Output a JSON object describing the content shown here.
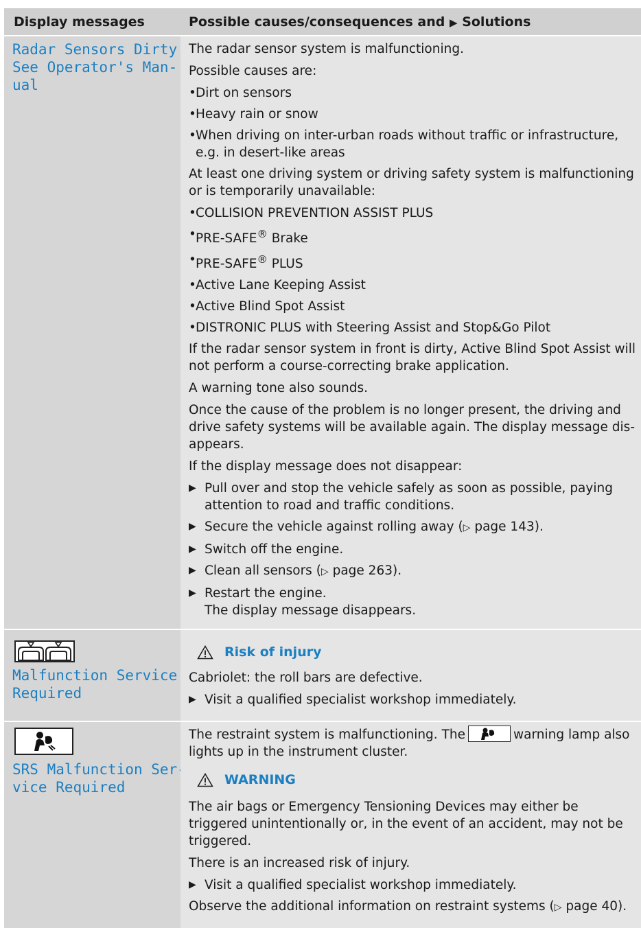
{
  "header": {
    "col1": "Display messages",
    "col2_prefix": "Possible causes/consequences and",
    "col2_arrow": "▶",
    "col2_suffix": "Solutions"
  },
  "row1": {
    "message": "Radar Sensors Dirty\nSee Operator's Man-\nual",
    "p1": "The radar sensor system is malfunctioning.",
    "p2": "Possible causes are:",
    "causes": [
      "Dirt on sensors",
      "Heavy rain or snow",
      "When driving on inter-urban roads without traffic or infrastructure, e.g. in desert-like areas"
    ],
    "p3": "At least one driving system or driving safety system is malfunctioning or is temporarily unavailable:",
    "systems": {
      "s1": "COLLISION PREVENTION ASSIST PLUS",
      "s2a": "PRE-SAFE",
      "s2b": " Brake",
      "s3a": "PRE-SAFE",
      "s3b": " PLUS",
      "s4": "Active Lane Keeping Assist",
      "s5": "Active Blind Spot Assist",
      "s6": "DISTRONIC PLUS with Steering Assist and Stop&Go Pilot",
      "reg": "®"
    },
    "p4": "If the radar sensor system in front is dirty, Active Blind Spot Assist will not perform a course-correcting brake application.",
    "p5": "A warning tone also sounds.",
    "p6": "Once the cause of the problem is no longer present, the driving and drive safety systems will be available again. The display message dis-appears.",
    "p7": "If the display message does not disappear:",
    "steps": {
      "s1": "Pull over and stop the vehicle safely as soon as possible, paying attention to road and traffic conditions.",
      "s2a": "Secure the vehicle against rolling away (",
      "s2ref": "▷",
      "s2b": " page 143).",
      "s3": "Switch off the engine.",
      "s4a": "Clean all sensors (",
      "s4ref": "▷",
      "s4b": " page 263).",
      "s5": "Restart the engine.",
      "s5result": "The display message disappears."
    }
  },
  "row2": {
    "icon": "roll-bar-icon",
    "message": "Malfunction Service\nRequired",
    "warning": "Risk of injury",
    "p1": "Cabriolet: the roll bars are defective.",
    "step": "Visit a qualified specialist workshop immediately."
  },
  "row3": {
    "icon": "srs-airbag-icon",
    "message": "SRS Malfunction Ser-\nvice Required",
    "p1a": "The restraint system is malfunctioning. The",
    "p1b": "warning lamp also lights up in the instrument cluster.",
    "warning": "WARNING",
    "p2": "The air bags or Emergency Tensioning Devices may either be triggered unintentionally or, in the event of an accident, may not be triggered.",
    "p3": "There is an increased risk of injury.",
    "step": "Visit a qualified specialist workshop immediately.",
    "p4a": "Observe the additional information on restraint systems (",
    "p4ref": "▷",
    "p4b": " page 40)."
  },
  "colors": {
    "accent": "#1b7fc2",
    "header_bg": "#d0d0d0",
    "left_bg": "#d6d6d6",
    "right_bg": "#e5e5e5"
  }
}
